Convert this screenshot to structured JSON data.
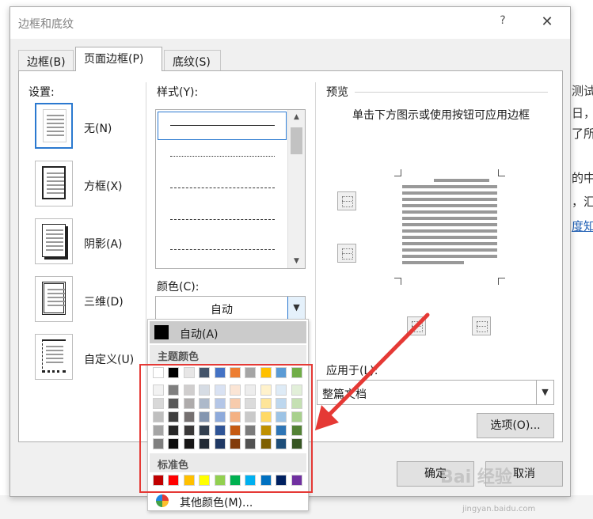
{
  "dialog": {
    "title": "边框和底纹",
    "help": "?",
    "close": "✕"
  },
  "tabs": [
    {
      "label": "边框(B)"
    },
    {
      "label": "页面边框(P)"
    },
    {
      "label": "底纹(S)"
    }
  ],
  "settings": {
    "label": "设置:",
    "items": [
      {
        "label": "无(N)"
      },
      {
        "label": "方框(X)"
      },
      {
        "label": "阴影(A)"
      },
      {
        "label": "三维(D)"
      },
      {
        "label": "自定义(U)"
      }
    ]
  },
  "style": {
    "label": "样式(Y):"
  },
  "color": {
    "label": "颜色(C):",
    "value": "自动"
  },
  "preview": {
    "label": "预览",
    "hint": "单击下方图示或使用按钮可应用边框"
  },
  "apply": {
    "label": "应用于(L):",
    "value": "整篇文档"
  },
  "buttons": {
    "options": "选项(O)...",
    "ok": "确定",
    "cancel": "取消"
  },
  "color_menu": {
    "auto": "自动(A)",
    "theme_label": "主题颜色",
    "standard_label": "标准色",
    "more": "其他颜色(M)...",
    "theme_top": [
      "#ffffff",
      "#000000",
      "#e7e6e6",
      "#44546a",
      "#4472c4",
      "#ed7d31",
      "#a5a5a5",
      "#ffc000",
      "#5b9bd5",
      "#70ad47"
    ],
    "theme_shades": [
      [
        "#f2f2f2",
        "#7f7f7f",
        "#d0cece",
        "#d6dce4",
        "#d9e2f3",
        "#fbe5d5",
        "#ededed",
        "#fff2cc",
        "#deebf6",
        "#e2efd9"
      ],
      [
        "#d8d8d8",
        "#595959",
        "#aeabab",
        "#adb9ca",
        "#b4c6e7",
        "#f7cbac",
        "#dbdbdb",
        "#fee599",
        "#bdd7ee",
        "#c5e0b3"
      ],
      [
        "#bfbfbf",
        "#3f3f3f",
        "#757070",
        "#8496b0",
        "#8eaadb",
        "#f4b183",
        "#c9c9c9",
        "#ffd965",
        "#9cc3e5",
        "#a8d08d"
      ],
      [
        "#a5a5a5",
        "#262626",
        "#3a3838",
        "#323f4f",
        "#2f5496",
        "#c55a11",
        "#7b7b7b",
        "#bf9000",
        "#2e75b5",
        "#538135"
      ],
      [
        "#7f7f7f",
        "#0c0c0c",
        "#171616",
        "#222a35",
        "#1f3864",
        "#833c0b",
        "#525252",
        "#7f6000",
        "#1e4e79",
        "#375623"
      ]
    ],
    "standard": [
      "#c00000",
      "#ff0000",
      "#ffc000",
      "#ffff00",
      "#92d050",
      "#00b050",
      "#00b0f0",
      "#0070c0",
      "#002060",
      "#7030a0"
    ]
  },
  "background_doc": {
    "lines": [
      "测试",
      "日，",
      "了所",
      "的中",
      "，汇",
      "度知"
    ]
  },
  "watermark": {
    "text": "Bai 经验",
    "url": "jingyan.baidu.com"
  }
}
